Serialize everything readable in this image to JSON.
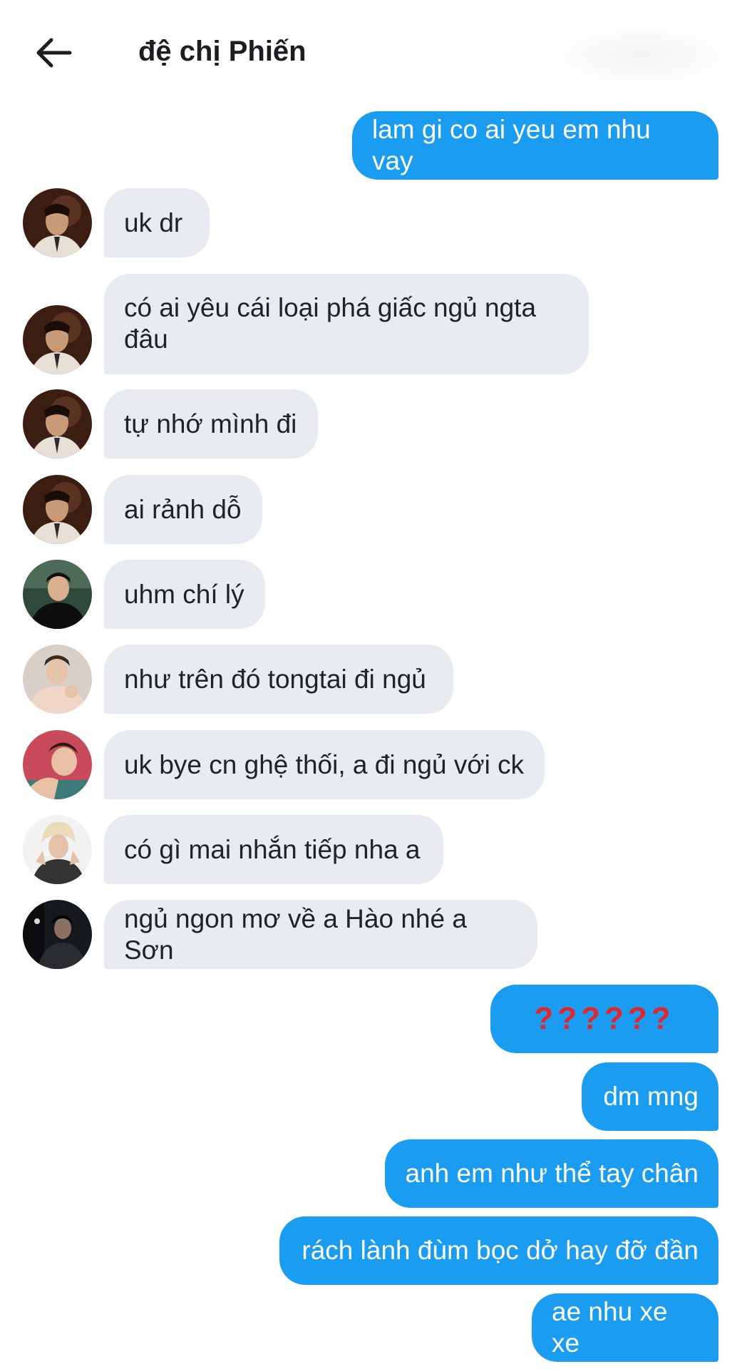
{
  "header": {
    "title": "đệ chị Phiến",
    "back_icon": "arrow-left-icon"
  },
  "colors": {
    "sent_bubble": "#1a9df0",
    "received_bubble": "#e8ebf0",
    "question_marks": "#e3262c"
  },
  "messages": [
    {
      "side": "sent",
      "text": "lam gi co ai yeu em nhu vay"
    },
    {
      "side": "received",
      "avatar": "avatar-dark-portrait",
      "text": "uk dr"
    },
    {
      "side": "received",
      "avatar": "avatar-dark-portrait",
      "text": "có ai yêu cái loại phá giấc ngủ ngta đâu"
    },
    {
      "side": "received",
      "avatar": "avatar-dark-portrait",
      "text": "tự nhớ mình đi"
    },
    {
      "side": "received",
      "avatar": "avatar-dark-portrait",
      "text": "ai rảnh dỗ"
    },
    {
      "side": "received",
      "avatar": "avatar-black-outfit",
      "text": "uhm chí lý"
    },
    {
      "side": "received",
      "avatar": "avatar-pink-sweater",
      "text": "như trên đó tongtai đi ngủ"
    },
    {
      "side": "received",
      "avatar": "avatar-red-background",
      "text": "uk bye cn ghệ thối, a đi ngủ với ck"
    },
    {
      "side": "received",
      "avatar": "avatar-blonde-hair",
      "text": "có gì mai nhắn tiếp nha a"
    },
    {
      "side": "received",
      "avatar": "avatar-dark-scene",
      "text": "ngủ ngon mơ về a Hào nhé a Sơn"
    },
    {
      "side": "sent",
      "text": "??????"
    },
    {
      "side": "sent",
      "text": "dm mng"
    },
    {
      "side": "sent",
      "text": "anh em như thể tay chân"
    },
    {
      "side": "sent",
      "text": "rách lành đùm bọc dở hay đỡ đần"
    },
    {
      "side": "sent",
      "text": "ae nhu xe xe"
    }
  ]
}
